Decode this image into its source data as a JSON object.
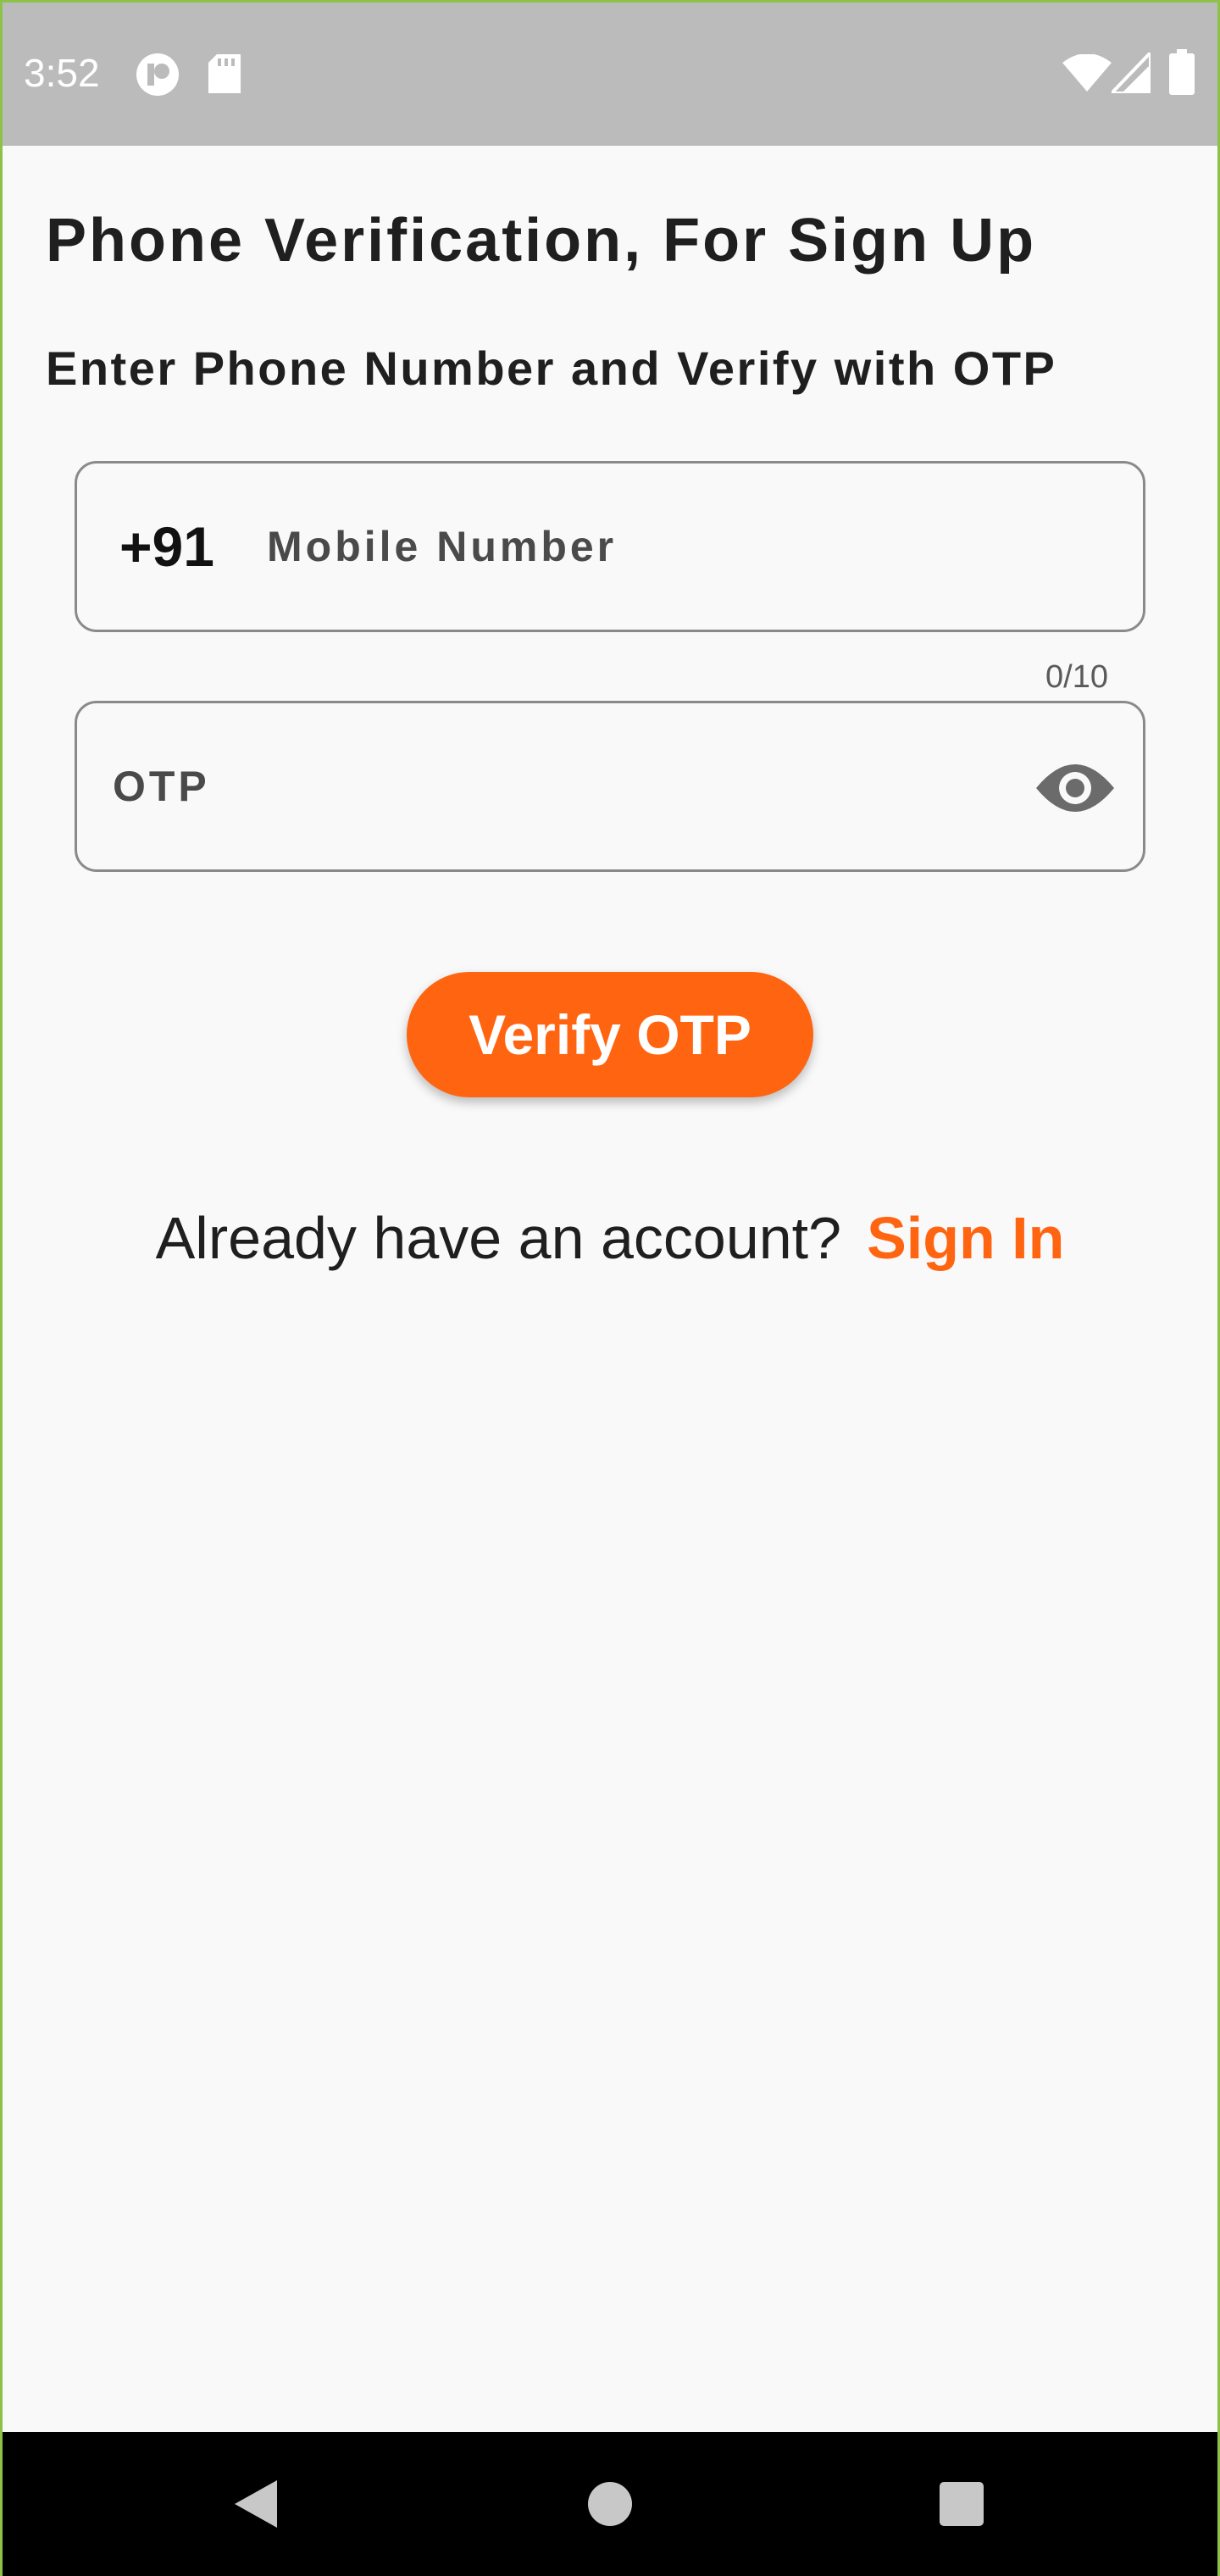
{
  "status_bar": {
    "time": "3:52",
    "left_icons": [
      "notification-app-icon",
      "sd-card-icon"
    ],
    "right_icons": [
      "wifi-icon",
      "cell-signal-icon",
      "battery-icon"
    ]
  },
  "page": {
    "title": "Phone Verification, For Sign Up",
    "subtitle": "Enter Phone Number and Verify with OTP"
  },
  "phone_field": {
    "prefix": "+91",
    "label": "Mobile Number",
    "value": "",
    "counter": "0/10"
  },
  "otp_field": {
    "label": "OTP",
    "value": "",
    "toggle_icon": "eye-icon"
  },
  "verify_button": {
    "label": "Verify OTP"
  },
  "signin": {
    "prompt": "Already have an account?",
    "link": "Sign In"
  },
  "nav_bar": {
    "icons": [
      "back-icon",
      "home-icon",
      "recents-icon"
    ]
  },
  "colors": {
    "accent": "#ff6411",
    "status_bar": "#bbbbbb",
    "background": "#f9f9f9",
    "field_border": "#8a8a8a",
    "nav_bar": "#000000"
  }
}
